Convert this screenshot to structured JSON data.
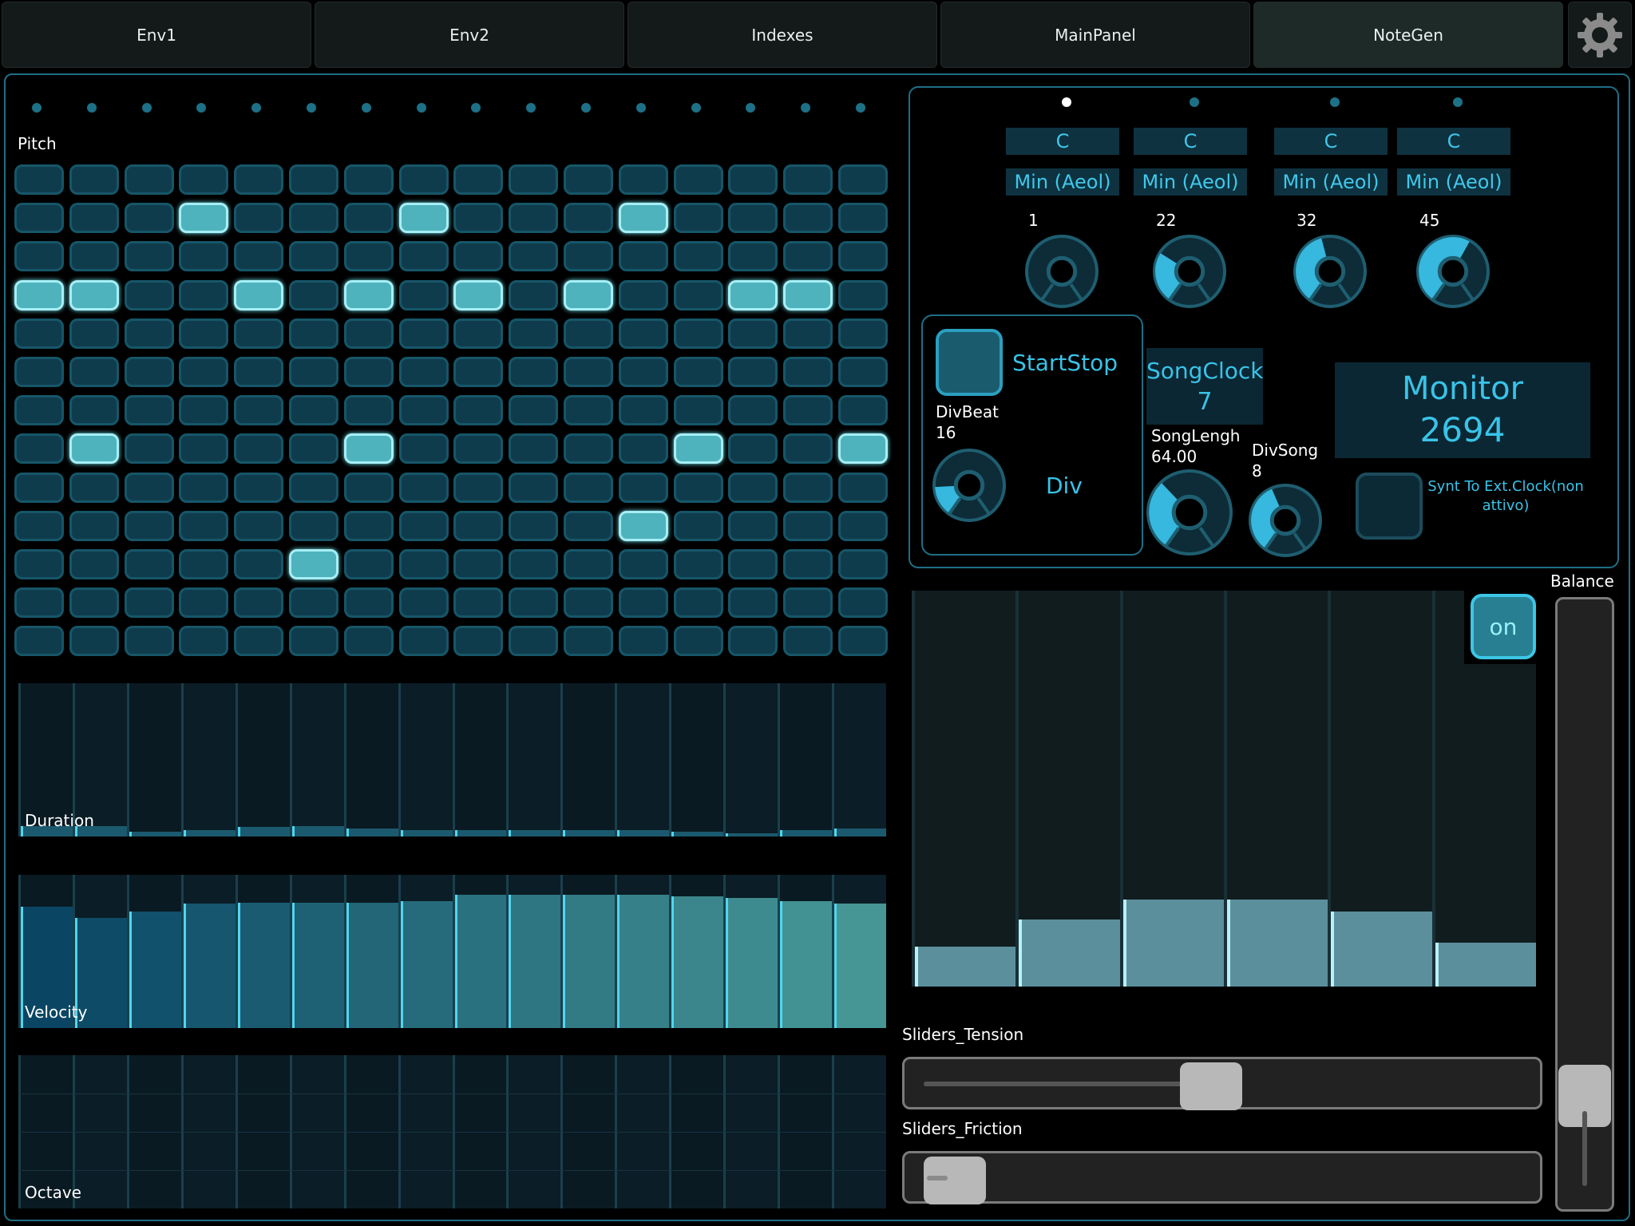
{
  "tabs": [
    {
      "label": "Env1"
    },
    {
      "label": "Env2"
    },
    {
      "label": "Indexes"
    },
    {
      "label": "MainPanel"
    },
    {
      "label": "NoteGen",
      "active": true
    }
  ],
  "icons": {
    "settings": "gear-icon"
  },
  "pitch": {
    "label": "Pitch",
    "steps": 16,
    "rows": 13,
    "active_row_per_step": [
      3,
      3,
      null,
      1,
      3,
      10,
      3,
      1,
      3,
      null,
      3,
      1,
      7,
      3,
      3,
      7
    ],
    "extra_on": [
      [
        7,
        6
      ],
      [
        7,
        12
      ],
      [
        9,
        11
      ],
      [
        7,
        1
      ]
    ],
    "current_step": null
  },
  "duration": {
    "label": "Duration",
    "values": [
      0.07,
      0.07,
      0.03,
      0.04,
      0.06,
      0.07,
      0.05,
      0.04,
      0.04,
      0.04,
      0.04,
      0.04,
      0.03,
      0.02,
      0.04,
      0.05
    ]
  },
  "velocity": {
    "label": "Velocity",
    "values": [
      0.79,
      0.72,
      0.76,
      0.81,
      0.82,
      0.82,
      0.82,
      0.83,
      0.87,
      0.87,
      0.87,
      0.87,
      0.86,
      0.85,
      0.83,
      0.81
    ]
  },
  "octave": {
    "label": "Octave",
    "values": [
      0,
      0,
      0,
      0,
      0,
      0,
      0,
      0,
      0,
      0,
      0,
      0,
      0,
      0,
      0,
      0
    ]
  },
  "voices": [
    {
      "root": "C",
      "scale": "Min (Aeol)",
      "value": "1",
      "knob": 0.0,
      "active": true
    },
    {
      "root": "C",
      "scale": "Min (Aeol)",
      "value": "22",
      "knob": 0.3,
      "active": false
    },
    {
      "root": "C",
      "scale": "Min (Aeol)",
      "value": "32",
      "knob": 0.45,
      "active": false
    },
    {
      "root": "C",
      "scale": "Min (Aeol)",
      "value": "45",
      "knob": 0.6,
      "active": false
    }
  ],
  "transport": {
    "startstop_label": "StartStop",
    "divbeat_label": "DivBeat",
    "divbeat_value": "16",
    "div_label": "Div",
    "songclock_label": "SongClock",
    "songclock_value": "7",
    "songlength_label": "SongLengh",
    "songlength_value": "64.00",
    "divsong_label": "DivSong",
    "divsong_value": "8",
    "monitor_label": "Monitor",
    "monitor_value": "2694",
    "sync_label": "Synt To Ext.Clock(non attivo)"
  },
  "env_bars": {
    "values": [
      0.1,
      0.17,
      0.22,
      0.22,
      0.19,
      0.11
    ],
    "on_label": "on"
  },
  "balance": {
    "label": "Balance",
    "value": 0.15
  },
  "tension": {
    "label": "Sliders_Tension",
    "value": 0.48
  },
  "friction": {
    "label": "Sliders_Friction",
    "value": 0.02
  },
  "colors": {
    "accent": "#39c3e8",
    "border": "#1f6f86",
    "cell_on": "#4fb3bd"
  }
}
